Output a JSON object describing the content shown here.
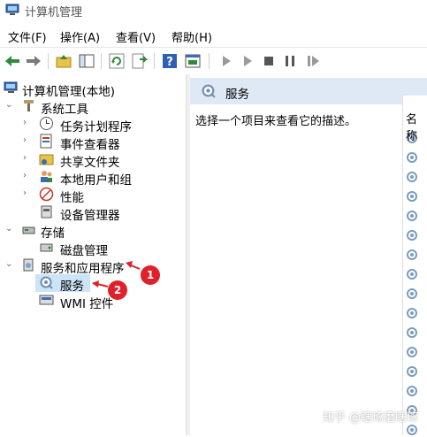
{
  "window": {
    "title": "计算机管理"
  },
  "menu": [
    "文件(F)",
    "操作(A)",
    "查看(V)",
    "帮助(H)"
  ],
  "tree": {
    "root": "计算机管理(本地)",
    "system_tools": "系统工具",
    "task_scheduler": "任务计划程序",
    "event_viewer": "事件查看器",
    "shared_folders": "共享文件夹",
    "local_users": "本地用户和组",
    "performance": "性能",
    "device_manager": "设备管理器",
    "storage": "存储",
    "disk_management": "磁盘管理",
    "services_apps": "服务和应用程序",
    "services": "服务",
    "wmi": "WMI 控件"
  },
  "annotations": [
    "1",
    "2"
  ],
  "right": {
    "header": "服务",
    "description": "选择一个项目来查看它的描述。",
    "column_name": "名称"
  },
  "watermark": "知乎 @瞎琢磨瞎琢"
}
